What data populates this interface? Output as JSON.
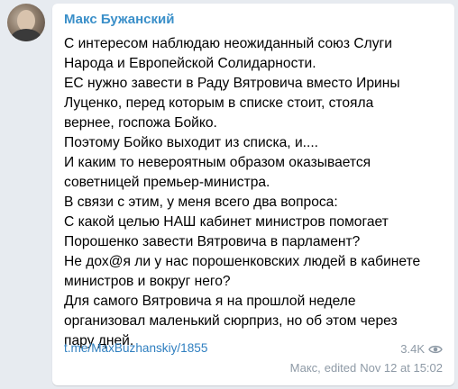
{
  "author": "Макс Бужанский",
  "message_lines": [
    "С интересом наблюдаю неожиданный союз Слуги",
    "Народа и Европейской Солидарности.",
    "ЕС нужно завести в Раду Вятровича вместо Ирины",
    "Луценко, перед которым в списке стоит, стояла",
    "вернее, госпожа Бойко.",
    "Поэтому Бойко выходит из списка, и....",
    "И каким то невероятным образом оказывается",
    "советницей премьер-министра.",
    "В связи с этим, у меня всего два вопроса:",
    "С какой целью НАШ кабинет министров помогает",
    "Порошенко завести Вятровича в парламент?",
    "Не дох@я ли у нас порошенковских людей в кабинете",
    "министров и вокруг него?",
    "Для самого Вятровича я на прошлой неделе",
    "организовал маленький сюрприз, но об этом через",
    "пару дней."
  ],
  "post_link": "t.me/MaxBuzhanskiy/1855",
  "views": "3.4K",
  "views_icon": "eye-icon",
  "signature": "Макс,",
  "edited_label": "edited",
  "date": "Nov 12 at 15:02",
  "colors": {
    "background": "#e7ebf0",
    "bubble": "#ffffff",
    "author": "#3a8fc9",
    "link": "#2f7fc0",
    "meta": "#8e9aa6"
  }
}
